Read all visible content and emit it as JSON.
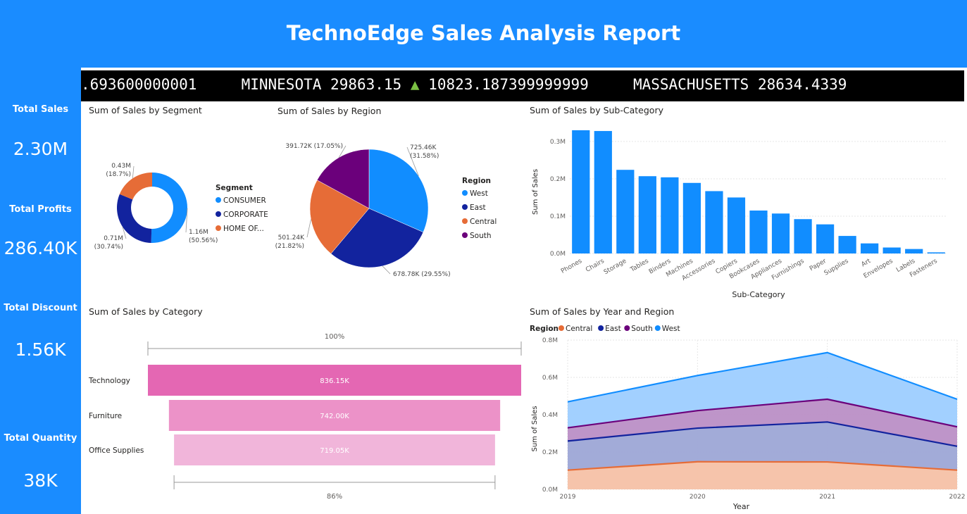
{
  "header": {
    "title": "TechnoEdge Sales Analysis Report"
  },
  "kpis": [
    {
      "label": "Total Sales",
      "value": "2.30M"
    },
    {
      "label": "Total Profits",
      "value": "286.40K"
    },
    {
      "label": "Total Discount",
      "value": "1.56K"
    },
    {
      "label": "Total Quantity",
      "value": "38K"
    }
  ],
  "ticker": {
    "lead": ".693600000001",
    "state1": "MINNESOTA",
    "sales1": "29863.15",
    "arrow": "▲",
    "profit1": "10823.187399999999",
    "state2": "MASSACHUSETTS",
    "sales2": "28634.4339"
  },
  "colors": {
    "brand_blue": "#1a8cff",
    "consumer": "#118dff",
    "corporate": "#12239e",
    "home_office": "#e66c37",
    "south": "#6b007b",
    "funnel_technology": "#e467b3",
    "funnel_furniture": "#ec92c8",
    "funnel_office": "#f1b5da"
  },
  "chart_data": [
    {
      "type": "pie",
      "variant": "donut",
      "title": "Sum of Sales by Segment",
      "legend_title": "Segment",
      "legend_position": "right",
      "labels": [
        "CONSUMER",
        "CORPORATE",
        "HOME OF..."
      ],
      "values": [
        1.16,
        0.71,
        0.43
      ],
      "data_labels": [
        [
          "1.16M",
          "(50.56%)"
        ],
        [
          "0.71M",
          "(30.74%)"
        ],
        [
          "0.43M",
          "(18.7%)"
        ]
      ]
    },
    {
      "type": "pie",
      "title": "Sum of Sales by Region",
      "legend_title": "Region",
      "legend_position": "right",
      "labels": [
        "West",
        "East",
        "Central",
        "South"
      ],
      "values": [
        725.46,
        678.78,
        501.24,
        391.72
      ],
      "data_labels": [
        [
          "725.46K",
          "(31.58%)"
        ],
        [
          "678.78K (29.55%)"
        ],
        [
          "501.24K",
          "(21.82%)"
        ],
        [
          "391.72K (17.05%)"
        ]
      ]
    },
    {
      "type": "bar",
      "title": "Sum of Sales by Sub-Category",
      "xlabel": "Sub-Category",
      "ylabel": "Sum of Sales",
      "ylim": [
        0,
        0.33
      ],
      "yticks": [
        "0.0M",
        "0.1M",
        "0.2M",
        "0.3M"
      ],
      "categories": [
        "Phones",
        "Chairs",
        "Storage",
        "Tables",
        "Binders",
        "Machines",
        "Accessories",
        "Copiers",
        "Bookcases",
        "Appliances",
        "Furnishings",
        "Paper",
        "Supplies",
        "Art",
        "Envelopes",
        "Labels",
        "Fasteners"
      ],
      "values": [
        0.33,
        0.328,
        0.224,
        0.207,
        0.204,
        0.189,
        0.167,
        0.15,
        0.115,
        0.107,
        0.092,
        0.078,
        0.047,
        0.027,
        0.016,
        0.012,
        0.003
      ]
    },
    {
      "type": "bar",
      "variant": "funnel",
      "title": "Sum of Sales by Category",
      "categories": [
        "Technology",
        "Furniture",
        "Office Supplies"
      ],
      "values": [
        836.15,
        742.0,
        719.05
      ],
      "data_labels": [
        "836.15K",
        "742.00K",
        "719.05K"
      ],
      "top_percent": "100%",
      "bottom_percent": "86%"
    },
    {
      "type": "area",
      "stacked": true,
      "title": "Sum of Sales by Year and Region",
      "legend_title": "Region",
      "legend_position": "top-left",
      "xlabel": "Year",
      "ylabel": "Sum of Sales",
      "ylim": [
        0,
        0.8
      ],
      "yticks": [
        "0.0M",
        "0.2M",
        "0.4M",
        "0.6M",
        "0.8M"
      ],
      "x": [
        "2019",
        "2020",
        "2021",
        "2022"
      ],
      "series": [
        {
          "name": "Central",
          "values": [
            0.103,
            0.148,
            0.147,
            0.103
          ]
        },
        {
          "name": "East",
          "values": [
            0.156,
            0.18,
            0.214,
            0.128
          ]
        },
        {
          "name": "South",
          "values": [
            0.071,
            0.094,
            0.122,
            0.104
          ]
        },
        {
          "name": "West",
          "values": [
            0.139,
            0.188,
            0.25,
            0.148
          ]
        }
      ]
    }
  ]
}
